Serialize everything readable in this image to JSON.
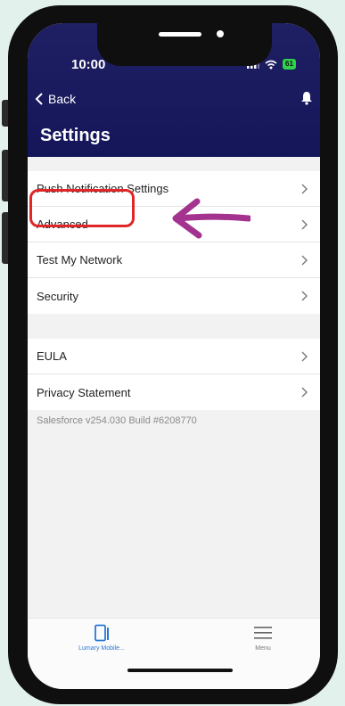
{
  "status_bar": {
    "time": "10:00",
    "battery": "61"
  },
  "nav": {
    "back_label": "Back",
    "title": "Settings"
  },
  "settings_group_1": [
    {
      "label": "Push Notification Settings"
    },
    {
      "label": "Advanced"
    },
    {
      "label": "Test My Network"
    },
    {
      "label": "Security"
    }
  ],
  "settings_group_2": [
    {
      "label": "EULA"
    },
    {
      "label": "Privacy Statement"
    }
  ],
  "version_text": "Salesforce v254.030 Build #6208770",
  "tabbar": {
    "tabs": [
      {
        "label": "Lumary Mobile...",
        "icon": "tablet-icon",
        "active": true
      },
      {
        "label": "Menu",
        "icon": "hamburger-icon",
        "active": false
      }
    ]
  },
  "colors": {
    "header": "#1c1c62",
    "highlight": "#e02626",
    "arrow": "#a3338f",
    "active_tab": "#2a78d6",
    "background": "#e3f1ec"
  },
  "icons": [
    "signal-icon",
    "wifi-icon",
    "battery-icon",
    "back-chevron-icon",
    "bell-icon",
    "chevron-right-icon",
    "arrow-annotation-icon"
  ]
}
